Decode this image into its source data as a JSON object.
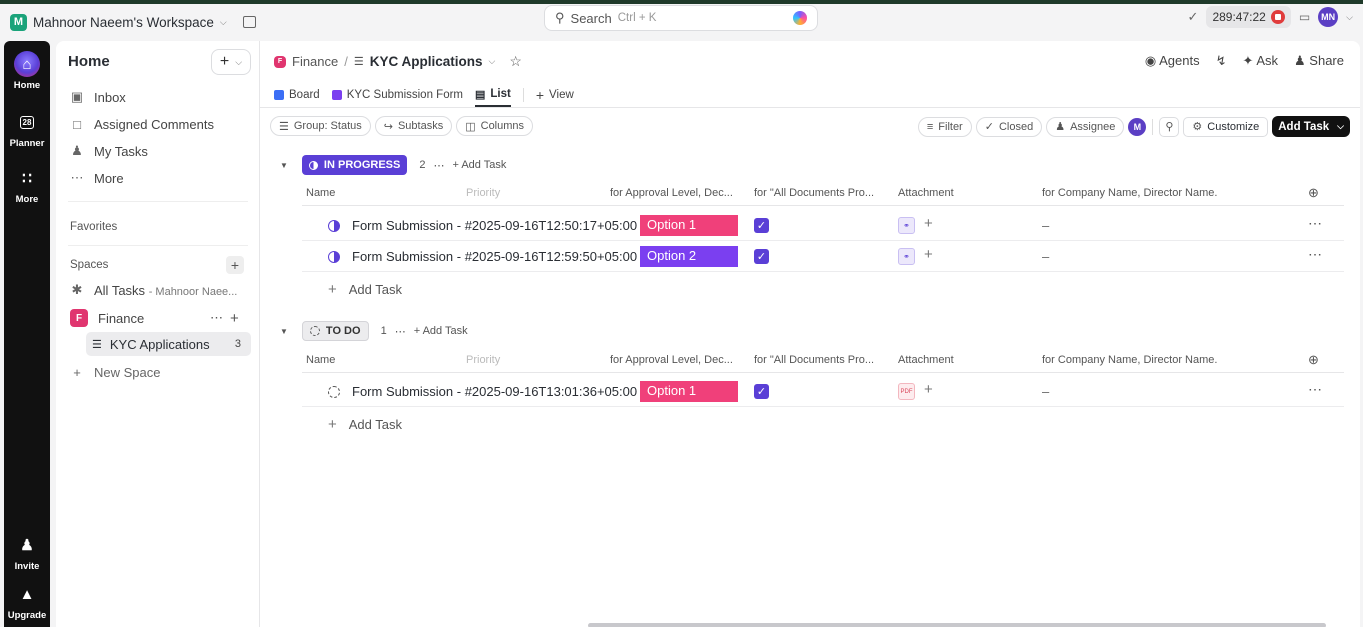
{
  "topbar": {
    "workspace_initial": "M",
    "workspace_name": "Mahnoor Naeem's Workspace",
    "search_label": "Search",
    "search_hint": "Ctrl + K",
    "timer": "289:47:22",
    "user_initials": "MN"
  },
  "rail": {
    "home": "Home",
    "planner": "Planner",
    "planner_day": "28",
    "more": "More",
    "invite": "Invite",
    "upgrade": "Upgrade"
  },
  "sidebar": {
    "title": "Home",
    "nav": [
      "Inbox",
      "Assigned Comments",
      "My Tasks",
      "More"
    ],
    "favorites_label": "Favorites",
    "spaces_label": "Spaces",
    "all_tasks_label": "All Tasks",
    "all_tasks_sub": "- Mahnoor Naee...",
    "finance_initial": "F",
    "finance_label": "Finance",
    "kyc_label": "KYC Applications",
    "kyc_count": "3",
    "new_space_label": "New Space"
  },
  "header": {
    "breadcrumb_space_initial": "F",
    "breadcrumb_space": "Finance",
    "breadcrumb_sep": "/",
    "breadcrumb_list": "KYC Applications",
    "agents": "Agents",
    "ask": "Ask",
    "share": "Share"
  },
  "tabs": {
    "board": "Board",
    "form": "KYC Submission Form",
    "list": "List",
    "view": "View"
  },
  "filters": {
    "group": "Group: Status",
    "subtasks": "Subtasks",
    "columns": "Columns",
    "filter": "Filter",
    "closed": "Closed",
    "assignee": "Assignee",
    "me_initial": "M",
    "customize": "Customize",
    "add_task": "Add Task"
  },
  "columns": [
    "Name",
    "Priority",
    "for Approval Level, Dec...",
    "for \"All Documents Pro...",
    "Attachment",
    "for Company Name, Director Name."
  ],
  "groups": {
    "in_progress": {
      "label": "IN PROGRESS",
      "count": "2",
      "add_label": "Add Task",
      "tasks": [
        {
          "name": "Form Submission - #2025-09-16T12:50:17+05:00",
          "option": "Option 1",
          "option_color": "#f0407a",
          "dash": "–"
        },
        {
          "name": "Form Submission - #2025-09-16T12:59:50+05:00",
          "option": "Option 2",
          "option_color": "#7b3ff0",
          "dash": "–"
        }
      ]
    },
    "todo": {
      "label": "TO DO",
      "count": "1",
      "add_label": "Add Task",
      "tasks": [
        {
          "name": "Form Submission - #2025-09-16T13:01:36+05:00",
          "option": "Option 1",
          "option_color": "#f0407a",
          "dash": "–"
        }
      ]
    }
  },
  "add_task_row": "Add Task"
}
